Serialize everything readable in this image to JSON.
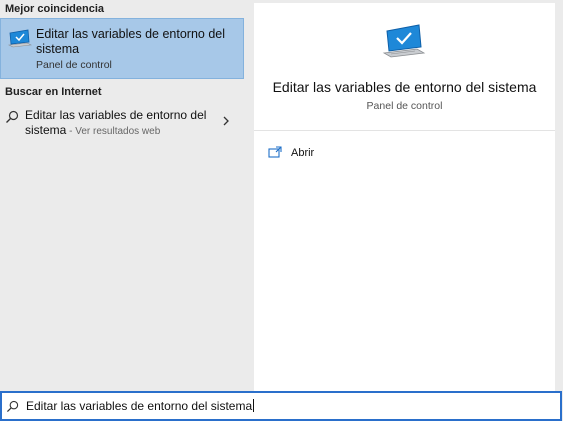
{
  "left": {
    "best_match_header": "Mejor coincidencia",
    "best_match": {
      "title": "Editar las variables de entorno del sistema",
      "subtitle": "Panel de control",
      "icon": "monitor-check-icon"
    },
    "web_header": "Buscar en Internet",
    "web_item": {
      "title": "Editar las variables de entorno del sistema",
      "hint": " - Ver resultados web",
      "icon": "search-icon",
      "arrow_icon": "chevron-right-icon"
    }
  },
  "right": {
    "title": "Editar las variables de entorno del sistema",
    "subtitle": "Panel de control",
    "icon": "monitor-check-icon",
    "actions": [
      {
        "label": "Abrir",
        "icon": "open-icon"
      }
    ]
  },
  "search": {
    "value": "Editar las variables de entorno del sistema",
    "icon": "search-icon"
  },
  "colors": {
    "selection": "#a7c8e8",
    "accent": "#2a6fcb",
    "panel_bg": "#ebebeb"
  }
}
